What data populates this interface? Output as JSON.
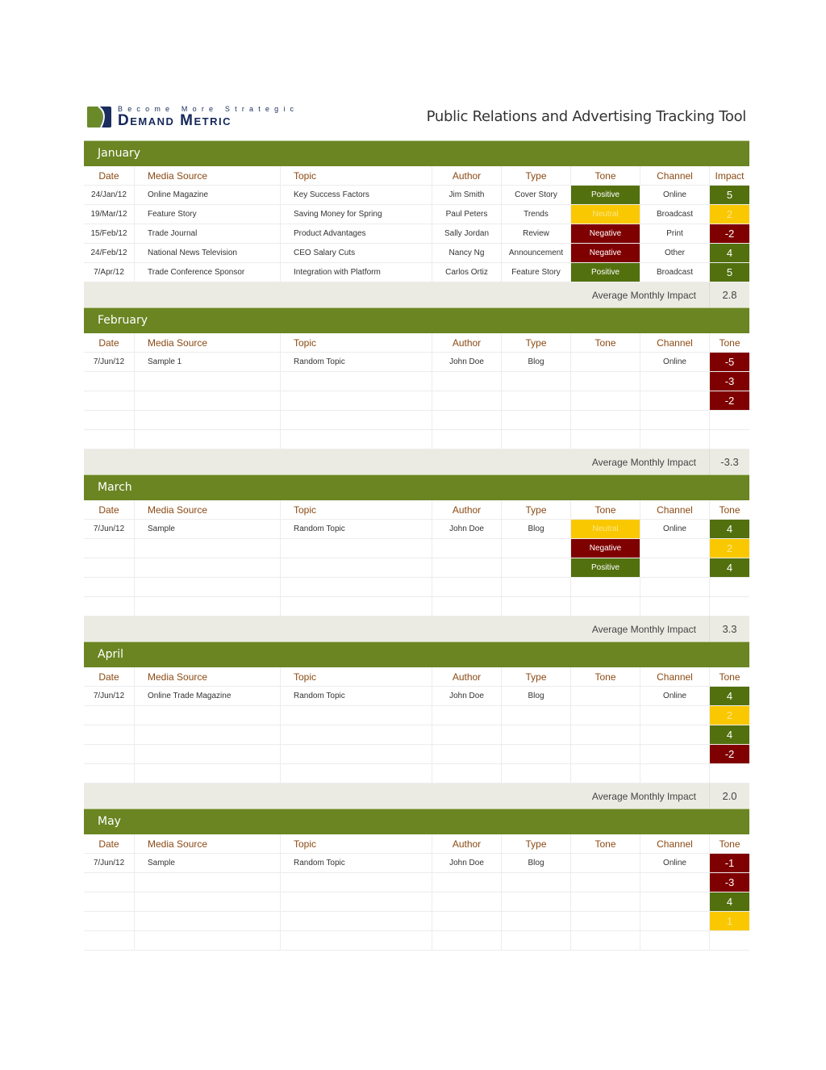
{
  "header": {
    "logo_tagline": "Become More Strategic",
    "logo_name": "Demand Metric",
    "title": "Public Relations and Advertising  Tracking Tool"
  },
  "colors": {
    "band": "#6a8522",
    "positive": "#53700f",
    "neutral": "#f9c800",
    "negative": "#7f0000",
    "header_text": "#8b4a14",
    "avg_row_bg": "#ecebe3"
  },
  "avg_label": "Average Monthly  Impact",
  "months": [
    {
      "name": "January",
      "columns": [
        "Date",
        "Media Source",
        "Topic",
        "Author",
        "Type",
        "Tone",
        "Channel",
        "Impact"
      ],
      "rows": [
        {
          "date": "24/Jan/12",
          "source": "Online Magazine",
          "topic": "Key Success Factors",
          "author": "Jim Smith",
          "type": "Cover Story",
          "tone": "Positive",
          "channel": "Online",
          "impact": "5",
          "impact_level": "pos"
        },
        {
          "date": "19/Mar/12",
          "source": "Feature Story",
          "topic": "Saving Money for Spring",
          "author": "Paul Peters",
          "type": "Trends",
          "tone": "Neutral",
          "channel": "Broadcast",
          "impact": "2",
          "impact_level": "neu"
        },
        {
          "date": "15/Feb/12",
          "source": "Trade Journal",
          "topic": "Product Advantages",
          "author": "Sally Jordan",
          "type": "Review",
          "tone": "Negative",
          "channel": "Print",
          "impact": "-2",
          "impact_level": "neg"
        },
        {
          "date": "24/Feb/12",
          "source": "National News Television",
          "topic": "CEO Salary Cuts",
          "author": "Nancy Ng",
          "type": "Announcement",
          "tone": "Negative",
          "channel": "Other",
          "impact": "4",
          "impact_level": "pos"
        },
        {
          "date": "7/Apr/12",
          "source": "Trade Conference Sponsor",
          "topic": "Integration with Platform",
          "author": "Carlos Ortiz",
          "type": "Feature Story",
          "tone": "Positive",
          "channel": "Broadcast",
          "impact": "5",
          "impact_level": "pos"
        }
      ],
      "avg_label": "Average Monthly  Impact",
      "avg": "2.8"
    },
    {
      "name": "February",
      "columns": [
        "Date",
        "Media Source",
        "Topic",
        "Author",
        "Type",
        "Tone",
        "Channel",
        "Tone"
      ],
      "rows": [
        {
          "date": "7/Jun/12",
          "source": "Sample 1",
          "topic": "Random Topic",
          "author": "John Doe",
          "type": "Blog",
          "tone": "",
          "channel": "Online",
          "impact": "-5",
          "impact_level": "neg"
        },
        {
          "date": "",
          "source": "",
          "topic": "",
          "author": "",
          "type": "",
          "tone": "",
          "channel": "",
          "impact": "-3",
          "impact_level": "neg"
        },
        {
          "date": "",
          "source": "",
          "topic": "",
          "author": "",
          "type": "",
          "tone": "",
          "channel": "",
          "impact": "-2",
          "impact_level": "neg"
        },
        {
          "date": "",
          "source": "",
          "topic": "",
          "author": "",
          "type": "",
          "tone": "",
          "channel": "",
          "impact": "",
          "impact_level": ""
        },
        {
          "date": "",
          "source": "",
          "topic": "",
          "author": "",
          "type": "",
          "tone": "",
          "channel": "",
          "impact": "",
          "impact_level": ""
        }
      ],
      "avg_label": "Average Monthly  Impact",
      "avg": "-3.3"
    },
    {
      "name": "March",
      "columns": [
        "Date",
        "Media Source",
        "Topic",
        "Author",
        "Type",
        "Tone",
        "Channel",
        "Tone"
      ],
      "rows": [
        {
          "date": "7/Jun/12",
          "source": "Sample",
          "topic": "Random Topic",
          "author": "John Doe",
          "type": "Blog",
          "tone": "Neutral",
          "channel": "Online",
          "impact": "4",
          "impact_level": "pos"
        },
        {
          "date": "",
          "source": "",
          "topic": "",
          "author": "",
          "type": "",
          "tone": "Negative",
          "channel": "",
          "impact": "2",
          "impact_level": "neu"
        },
        {
          "date": "",
          "source": "",
          "topic": "",
          "author": "",
          "type": "",
          "tone": "Positive",
          "channel": "",
          "impact": "4",
          "impact_level": "pos"
        },
        {
          "date": "",
          "source": "",
          "topic": "",
          "author": "",
          "type": "",
          "tone": "",
          "channel": "",
          "impact": "",
          "impact_level": ""
        },
        {
          "date": "",
          "source": "",
          "topic": "",
          "author": "",
          "type": "",
          "tone": "",
          "channel": "",
          "impact": "",
          "impact_level": ""
        }
      ],
      "avg_label": "Average Monthly Impact",
      "avg": "3.3"
    },
    {
      "name": "April",
      "columns": [
        "Date",
        "Media Source",
        "Topic",
        "Author",
        "Type",
        "Tone",
        "Channel",
        "Tone"
      ],
      "rows": [
        {
          "date": "7/Jun/12",
          "source": "Online Trade Magazine",
          "topic": "Random Topic",
          "author": "John Doe",
          "type": "Blog",
          "tone": "",
          "channel": "Online",
          "impact": "4",
          "impact_level": "pos"
        },
        {
          "date": "",
          "source": "",
          "topic": "",
          "author": "",
          "type": "",
          "tone": "",
          "channel": "",
          "impact": "2",
          "impact_level": "neu"
        },
        {
          "date": "",
          "source": "",
          "topic": "",
          "author": "",
          "type": "",
          "tone": "",
          "channel": "",
          "impact": "4",
          "impact_level": "pos"
        },
        {
          "date": "",
          "source": "",
          "topic": "",
          "author": "",
          "type": "",
          "tone": "",
          "channel": "",
          "impact": "-2",
          "impact_level": "neg"
        },
        {
          "date": "",
          "source": "",
          "topic": "",
          "author": "",
          "type": "",
          "tone": "",
          "channel": "",
          "impact": "",
          "impact_level": ""
        }
      ],
      "avg_label": "Average Monthly Impact",
      "avg": "2.0"
    },
    {
      "name": "May",
      "columns": [
        "Date",
        "Media Source",
        "Topic",
        "Author",
        "Type",
        "Tone",
        "Channel",
        "Tone"
      ],
      "rows": [
        {
          "date": "7/Jun/12",
          "source": "Sample",
          "topic": "Random Topic",
          "author": "John Doe",
          "type": "Blog",
          "tone": "",
          "channel": "Online",
          "impact": "-1",
          "impact_level": "neg"
        },
        {
          "date": "",
          "source": "",
          "topic": "",
          "author": "",
          "type": "",
          "tone": "",
          "channel": "",
          "impact": "-3",
          "impact_level": "neg"
        },
        {
          "date": "",
          "source": "",
          "topic": "",
          "author": "",
          "type": "",
          "tone": "",
          "channel": "",
          "impact": "4",
          "impact_level": "pos"
        },
        {
          "date": "",
          "source": "",
          "topic": "",
          "author": "",
          "type": "",
          "tone": "",
          "channel": "",
          "impact": "1",
          "impact_level": "neu"
        },
        {
          "date": "",
          "source": "",
          "topic": "",
          "author": "",
          "type": "",
          "tone": "",
          "channel": "",
          "impact": "",
          "impact_level": ""
        }
      ],
      "avg_label": "",
      "avg": ""
    }
  ]
}
